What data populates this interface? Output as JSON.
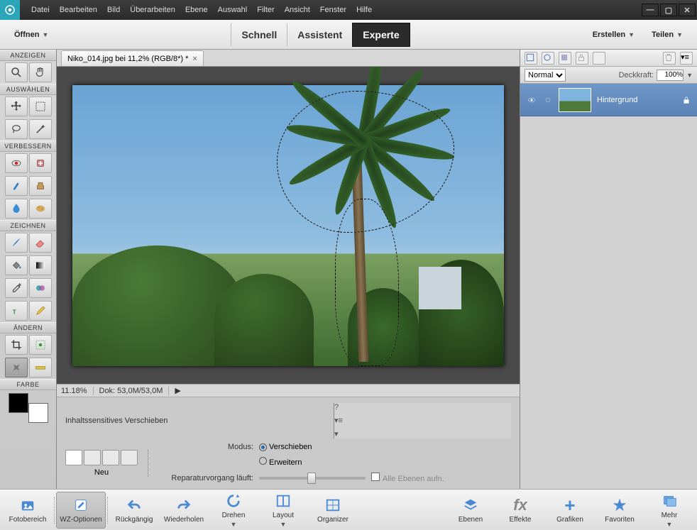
{
  "menu": {
    "items": [
      "Datei",
      "Bearbeiten",
      "Bild",
      "Überarbeiten",
      "Ebene",
      "Auswahl",
      "Filter",
      "Ansicht",
      "Fenster",
      "Hilfe"
    ]
  },
  "bar2": {
    "open": "Öffnen",
    "tabs": [
      "Schnell",
      "Assistent",
      "Experte"
    ],
    "active": 2,
    "create": "Erstellen",
    "share": "Teilen"
  },
  "toolbox": {
    "sections": [
      "ANZEIGEN",
      "AUSWÄHLEN",
      "VERBESSERN",
      "ZEICHNEN",
      "ÄNDERN",
      "FARBE"
    ]
  },
  "document": {
    "tab": "Niko_014.jpg bei 11,2% (RGB/8*) *"
  },
  "status": {
    "zoom": "11.18%",
    "doc": "Dok: 53,0M/53,0M"
  },
  "options": {
    "title": "Inhaltssensitives Verschieben",
    "neu": "Neu",
    "modus_label": "Modus:",
    "mode1": "Verschieben",
    "mode2": "Erweitern",
    "repair_label": "Reparaturvorgang läuft:",
    "all_layers": "Alle Ebenen aufn."
  },
  "layers": {
    "blend_mode": "Normal",
    "opacity_label": "Deckkraft:",
    "opacity_value": "100%",
    "layer0": "Hintergrund"
  },
  "bottom": {
    "items": [
      "Fotobereich",
      "WZ-Optionen",
      "Rückgängig",
      "Wiederholen",
      "Drehen",
      "Layout",
      "Organizer",
      "Ebenen",
      "Effekte",
      "Grafiken",
      "Favoriten",
      "Mehr"
    ],
    "selected": 1
  }
}
